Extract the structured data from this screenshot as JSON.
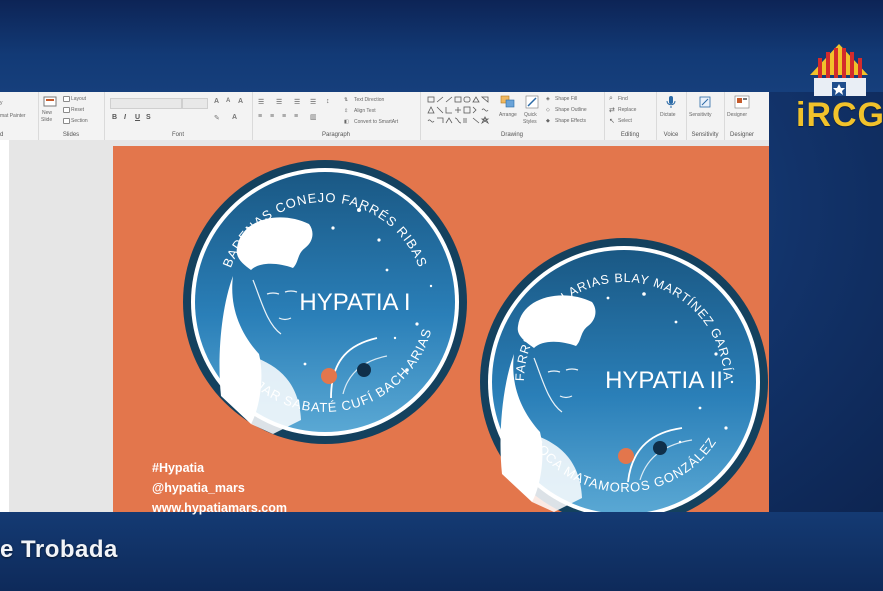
{
  "ribbon": {
    "clipboard": {
      "format_painter": "mat Painter",
      "group_label": "d"
    },
    "slides": {
      "new_slide": "New",
      "new_slide_line2": "Slide",
      "layout": "Layout",
      "reset": "Reset",
      "section": "Section",
      "group_label": "Slides"
    },
    "font": {
      "group_label": "Font"
    },
    "paragraph": {
      "text_direction": "Text Direction",
      "align_text": "Align Text",
      "convert_smartart": "Convert to SmartArt",
      "group_label": "Paragraph"
    },
    "drawing": {
      "arrange": "Arrange",
      "quick_styles": "Quick",
      "quick_styles_line2": "Styles",
      "shape_fill": "Shape Fill",
      "shape_outline": "Shape Outline",
      "shape_effects": "Shape Effects",
      "group_label": "Drawing"
    },
    "editing": {
      "find": "Find",
      "replace": "Replace",
      "select": "Select",
      "group_label": "Editing"
    },
    "voice": {
      "dictate": "Dictate",
      "group_label": "Voice"
    },
    "sensitivity": {
      "label": "Sensitivity",
      "group_label": "Sensitivity"
    },
    "designer": {
      "label": "Designer",
      "group_label": "Designer"
    }
  },
  "slide": {
    "patch1": {
      "title": "HYPATIA I",
      "names_top": "BADENAS CONEJO FARRÉS RIBAS",
      "names_bottom": "JAR SABATÉ CUFÍ BACH ARIAS"
    },
    "patch2": {
      "title": "HYPATIA II",
      "names_top": "FARRÉS BACH ARIAS BLAY MARTÍNEZ GARCÍA",
      "names_bottom": "ROCA MATAMOROS GONZÁLEZ"
    },
    "hashtag": "#Hypatia",
    "handle": "@hypatia_mars",
    "website": "www.hypatiamars.com"
  },
  "overlay": {
    "lower_third": "e Trobada",
    "logo_text": "iRCG"
  },
  "colors": {
    "slide_bg": "#e3764c",
    "patch_dark": "#14415e",
    "patch_blue": "#2a7fb8",
    "logo_yellow": "#f1c22b",
    "logo_red": "#d42b2b"
  }
}
